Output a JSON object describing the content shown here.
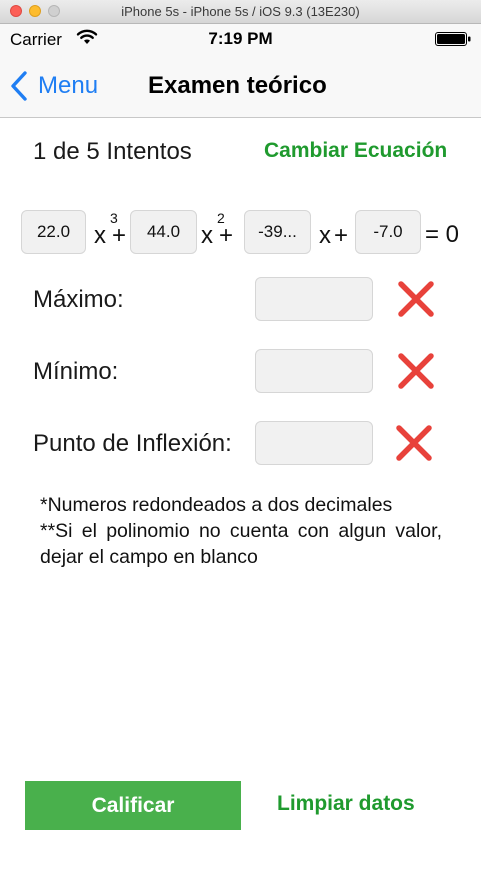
{
  "window": {
    "title": "iPhone 5s - iPhone 5s / iOS 9.3 (13E230)"
  },
  "status_bar": {
    "carrier": "Carrier",
    "time": "7:19 PM"
  },
  "nav": {
    "back_label": "Menu",
    "title": "Examen teórico"
  },
  "attempts_label": "1 de 5 Intentos",
  "change_equation_label": "Cambiar Ecuación",
  "equation": {
    "coefficients": [
      "22.0",
      "44.0",
      "-39...",
      "-7.0"
    ],
    "var": "x",
    "plus": "+",
    "exp3": "3",
    "exp2": "2",
    "equals": "= 0"
  },
  "fields": [
    {
      "label": "Máximo:",
      "value": ""
    },
    {
      "label": "Mínimo:",
      "value": ""
    },
    {
      "label": "Punto de Inflexión:",
      "value": ""
    }
  ],
  "notes": {
    "line1": "*Numeros redondeados a dos decimales",
    "line2": "**Si el polinomio no cuenta con algun valor, dejar el campo en blanco"
  },
  "buttons": {
    "grade": "Calificar",
    "clear": "Limpiar datos"
  },
  "colors": {
    "accent_blue": "#1f7ef3",
    "accent_green": "#1f9a2e",
    "button_green": "#49b04c",
    "error_red": "#e8423b"
  }
}
